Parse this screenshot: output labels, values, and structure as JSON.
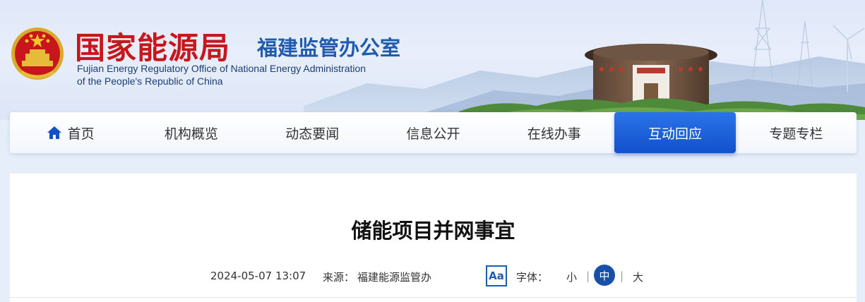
{
  "header": {
    "title_cn": "国家能源局",
    "subtitle_cn": "福建监管办公室",
    "title_en_line1": "Fujian Energy Regulatory Office of National Energy Administration",
    "title_en_line2": "of the People's Republic of China"
  },
  "nav": {
    "items": [
      {
        "label": "首页",
        "icon": "home-icon"
      },
      {
        "label": "机构概览"
      },
      {
        "label": "动态要闻"
      },
      {
        "label": "信息公开"
      },
      {
        "label": "在线办事"
      },
      {
        "label": "互动回应",
        "active": true
      },
      {
        "label": "专题专栏"
      }
    ]
  },
  "article": {
    "title": "储能项目并网事宜",
    "date": "2024-05-07 13:07",
    "source_label": "来源：",
    "source_value": "福建能源监管办",
    "font_icon_text": "Aa",
    "font_label": "字体：",
    "font_small": "小",
    "font_medium": "中",
    "font_large": "大",
    "separator": "|"
  },
  "colors": {
    "brand_red": "#c8161d",
    "brand_blue": "#1f5cae",
    "nav_active": "#1a5fd8"
  }
}
